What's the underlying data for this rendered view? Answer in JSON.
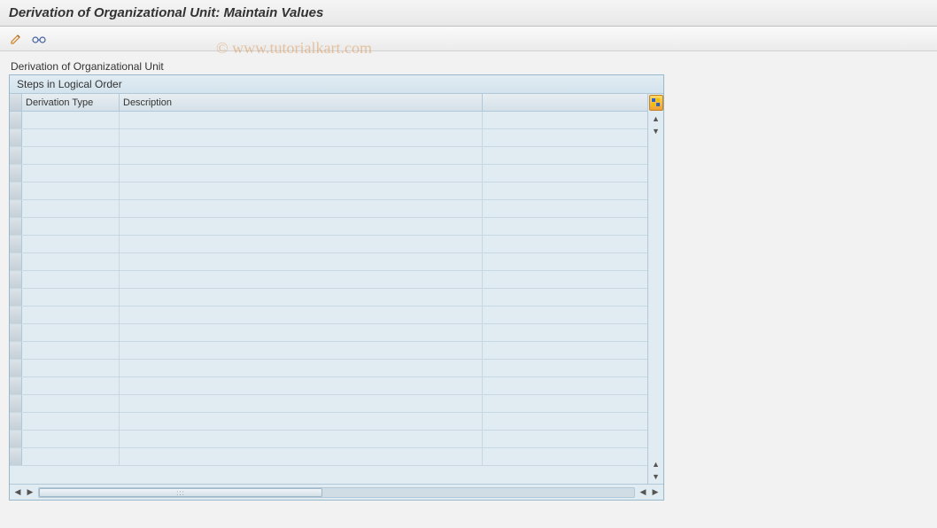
{
  "title": "Derivation of Organizational Unit: Maintain Values",
  "watermark": "© www.tutorialkart.com",
  "toolbar": {
    "edit_icon": "pencil-icon",
    "display_icon": "glasses-icon"
  },
  "panel": {
    "label": "Derivation of Organizational Unit",
    "header": "Steps in Logical Order",
    "columns": {
      "derivation_type": "Derivation Type",
      "description": "Description"
    },
    "rows": [
      {
        "type": "",
        "desc": ""
      },
      {
        "type": "",
        "desc": ""
      },
      {
        "type": "",
        "desc": ""
      },
      {
        "type": "",
        "desc": ""
      },
      {
        "type": "",
        "desc": ""
      },
      {
        "type": "",
        "desc": ""
      },
      {
        "type": "",
        "desc": ""
      },
      {
        "type": "",
        "desc": ""
      },
      {
        "type": "",
        "desc": ""
      },
      {
        "type": "",
        "desc": ""
      },
      {
        "type": "",
        "desc": ""
      },
      {
        "type": "",
        "desc": ""
      },
      {
        "type": "",
        "desc": ""
      },
      {
        "type": "",
        "desc": ""
      },
      {
        "type": "",
        "desc": ""
      },
      {
        "type": "",
        "desc": ""
      },
      {
        "type": "",
        "desc": ""
      },
      {
        "type": "",
        "desc": ""
      },
      {
        "type": "",
        "desc": ""
      },
      {
        "type": "",
        "desc": ""
      }
    ]
  }
}
